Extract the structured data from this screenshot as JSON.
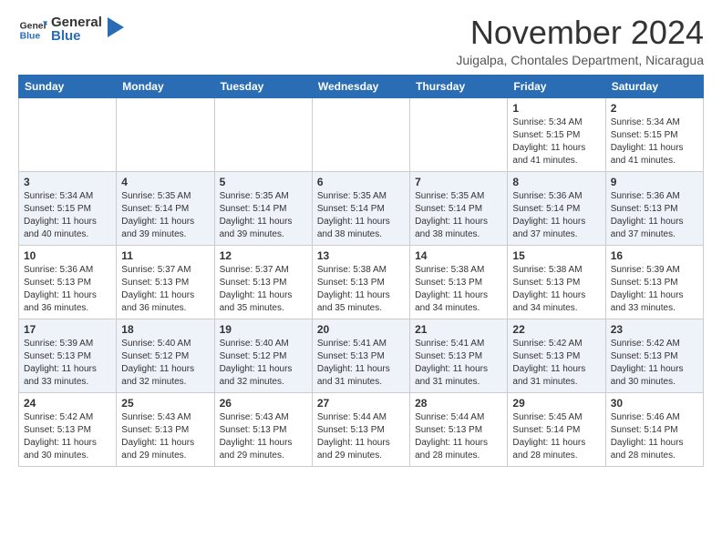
{
  "header": {
    "logo_general": "General",
    "logo_blue": "Blue",
    "month_title": "November 2024",
    "location": "Juigalpa, Chontales Department, Nicaragua"
  },
  "calendar": {
    "days_of_week": [
      "Sunday",
      "Monday",
      "Tuesday",
      "Wednesday",
      "Thursday",
      "Friday",
      "Saturday"
    ],
    "weeks": [
      [
        {
          "day": "",
          "info": ""
        },
        {
          "day": "",
          "info": ""
        },
        {
          "day": "",
          "info": ""
        },
        {
          "day": "",
          "info": ""
        },
        {
          "day": "",
          "info": ""
        },
        {
          "day": "1",
          "info": "Sunrise: 5:34 AM\nSunset: 5:15 PM\nDaylight: 11 hours\nand 41 minutes."
        },
        {
          "day": "2",
          "info": "Sunrise: 5:34 AM\nSunset: 5:15 PM\nDaylight: 11 hours\nand 41 minutes."
        }
      ],
      [
        {
          "day": "3",
          "info": "Sunrise: 5:34 AM\nSunset: 5:15 PM\nDaylight: 11 hours\nand 40 minutes."
        },
        {
          "day": "4",
          "info": "Sunrise: 5:35 AM\nSunset: 5:14 PM\nDaylight: 11 hours\nand 39 minutes."
        },
        {
          "day": "5",
          "info": "Sunrise: 5:35 AM\nSunset: 5:14 PM\nDaylight: 11 hours\nand 39 minutes."
        },
        {
          "day": "6",
          "info": "Sunrise: 5:35 AM\nSunset: 5:14 PM\nDaylight: 11 hours\nand 38 minutes."
        },
        {
          "day": "7",
          "info": "Sunrise: 5:35 AM\nSunset: 5:14 PM\nDaylight: 11 hours\nand 38 minutes."
        },
        {
          "day": "8",
          "info": "Sunrise: 5:36 AM\nSunset: 5:14 PM\nDaylight: 11 hours\nand 37 minutes."
        },
        {
          "day": "9",
          "info": "Sunrise: 5:36 AM\nSunset: 5:13 PM\nDaylight: 11 hours\nand 37 minutes."
        }
      ],
      [
        {
          "day": "10",
          "info": "Sunrise: 5:36 AM\nSunset: 5:13 PM\nDaylight: 11 hours\nand 36 minutes."
        },
        {
          "day": "11",
          "info": "Sunrise: 5:37 AM\nSunset: 5:13 PM\nDaylight: 11 hours\nand 36 minutes."
        },
        {
          "day": "12",
          "info": "Sunrise: 5:37 AM\nSunset: 5:13 PM\nDaylight: 11 hours\nand 35 minutes."
        },
        {
          "day": "13",
          "info": "Sunrise: 5:38 AM\nSunset: 5:13 PM\nDaylight: 11 hours\nand 35 minutes."
        },
        {
          "day": "14",
          "info": "Sunrise: 5:38 AM\nSunset: 5:13 PM\nDaylight: 11 hours\nand 34 minutes."
        },
        {
          "day": "15",
          "info": "Sunrise: 5:38 AM\nSunset: 5:13 PM\nDaylight: 11 hours\nand 34 minutes."
        },
        {
          "day": "16",
          "info": "Sunrise: 5:39 AM\nSunset: 5:13 PM\nDaylight: 11 hours\nand 33 minutes."
        }
      ],
      [
        {
          "day": "17",
          "info": "Sunrise: 5:39 AM\nSunset: 5:13 PM\nDaylight: 11 hours\nand 33 minutes."
        },
        {
          "day": "18",
          "info": "Sunrise: 5:40 AM\nSunset: 5:12 PM\nDaylight: 11 hours\nand 32 minutes."
        },
        {
          "day": "19",
          "info": "Sunrise: 5:40 AM\nSunset: 5:12 PM\nDaylight: 11 hours\nand 32 minutes."
        },
        {
          "day": "20",
          "info": "Sunrise: 5:41 AM\nSunset: 5:13 PM\nDaylight: 11 hours\nand 31 minutes."
        },
        {
          "day": "21",
          "info": "Sunrise: 5:41 AM\nSunset: 5:13 PM\nDaylight: 11 hours\nand 31 minutes."
        },
        {
          "day": "22",
          "info": "Sunrise: 5:42 AM\nSunset: 5:13 PM\nDaylight: 11 hours\nand 31 minutes."
        },
        {
          "day": "23",
          "info": "Sunrise: 5:42 AM\nSunset: 5:13 PM\nDaylight: 11 hours\nand 30 minutes."
        }
      ],
      [
        {
          "day": "24",
          "info": "Sunrise: 5:42 AM\nSunset: 5:13 PM\nDaylight: 11 hours\nand 30 minutes."
        },
        {
          "day": "25",
          "info": "Sunrise: 5:43 AM\nSunset: 5:13 PM\nDaylight: 11 hours\nand 29 minutes."
        },
        {
          "day": "26",
          "info": "Sunrise: 5:43 AM\nSunset: 5:13 PM\nDaylight: 11 hours\nand 29 minutes."
        },
        {
          "day": "27",
          "info": "Sunrise: 5:44 AM\nSunset: 5:13 PM\nDaylight: 11 hours\nand 29 minutes."
        },
        {
          "day": "28",
          "info": "Sunrise: 5:44 AM\nSunset: 5:13 PM\nDaylight: 11 hours\nand 28 minutes."
        },
        {
          "day": "29",
          "info": "Sunrise: 5:45 AM\nSunset: 5:14 PM\nDaylight: 11 hours\nand 28 minutes."
        },
        {
          "day": "30",
          "info": "Sunrise: 5:46 AM\nSunset: 5:14 PM\nDaylight: 11 hours\nand 28 minutes."
        }
      ]
    ]
  }
}
